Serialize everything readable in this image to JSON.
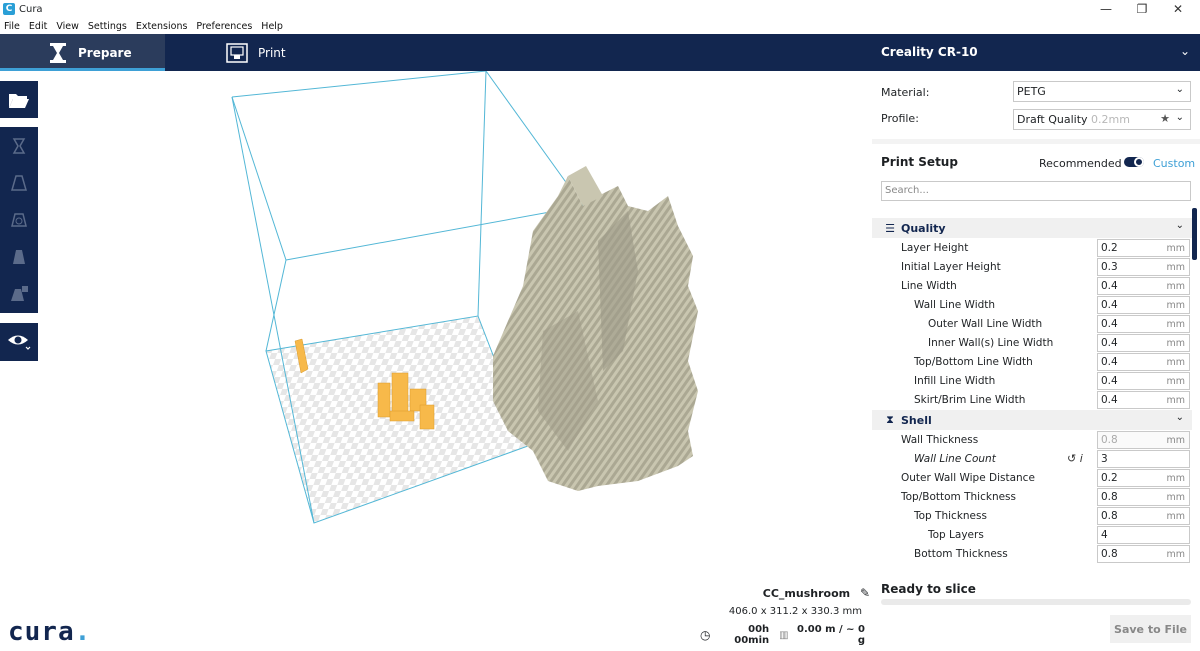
{
  "window": {
    "title": "Cura",
    "icon_letter": "C",
    "minimize": "—",
    "maximize": "❐",
    "close": "✕"
  },
  "menu": [
    "File",
    "Edit",
    "View",
    "Settings",
    "Extensions",
    "Preferences",
    "Help"
  ],
  "header": {
    "tab_prepare": "Prepare",
    "tab_print": "Print",
    "printer": "Creality CR-10",
    "chevron": "⌄"
  },
  "colors": {
    "navy": "#12264f",
    "accent": "#3ea0d6",
    "model": "#c9c6b0",
    "object": "#f7b94a"
  },
  "toolbar": {
    "open_icon": "folder-open-icon",
    "tools": [
      "move-icon",
      "scale-icon",
      "rotate-icon",
      "mirror-icon",
      "per-model-settings-icon"
    ],
    "view_icon": "eye-icon"
  },
  "viewport": {
    "logo_text": "cura",
    "logo_dot": ".",
    "job_name": "CC_mushroom",
    "dimensions": "406.0 x 311.2 x 330.3 mm",
    "time": "00h 00min",
    "material_usage": "0.00 m / ~ 0 g"
  },
  "panel": {
    "material_label": "Material:",
    "material_value": "PETG",
    "profile_label": "Profile:",
    "profile_value": "Draft Quality",
    "profile_layer": "0.2mm",
    "setup_title": "Print Setup",
    "mode_recommended": "Recommended",
    "mode_custom": "Custom",
    "search_placeholder": "Search...",
    "quality_label": "Quality",
    "shell_label": "Shell",
    "quality_settings": [
      {
        "label": "Layer Height",
        "value": "0.2",
        "unit": "mm"
      },
      {
        "label": "Initial Layer Height",
        "value": "0.3",
        "unit": "mm"
      },
      {
        "label": "Line Width",
        "value": "0.4",
        "unit": "mm"
      },
      {
        "label": "Wall Line Width",
        "value": "0.4",
        "unit": "mm"
      },
      {
        "label": "Outer Wall Line Width",
        "value": "0.4",
        "unit": "mm"
      },
      {
        "label": "Inner Wall(s) Line Width",
        "value": "0.4",
        "unit": "mm"
      },
      {
        "label": "Top/Bottom Line Width",
        "value": "0.4",
        "unit": "mm"
      },
      {
        "label": "Infill Line Width",
        "value": "0.4",
        "unit": "mm"
      },
      {
        "label": "Skirt/Brim Line Width",
        "value": "0.4",
        "unit": "mm"
      }
    ],
    "shell_settings": [
      {
        "label": "Wall Thickness",
        "value": "0.8",
        "unit": "mm"
      },
      {
        "label": "Wall Line Count",
        "value": "3",
        "unit": ""
      },
      {
        "label": "Outer Wall Wipe Distance",
        "value": "0.2",
        "unit": "mm"
      },
      {
        "label": "Top/Bottom Thickness",
        "value": "0.8",
        "unit": "mm"
      },
      {
        "label": "Top Thickness",
        "value": "0.8",
        "unit": "mm"
      },
      {
        "label": "Top Layers",
        "value": "4",
        "unit": ""
      },
      {
        "label": "Bottom Thickness",
        "value": "0.8",
        "unit": "mm"
      }
    ],
    "slice_status": "Ready to slice",
    "save_button": "Save to File"
  }
}
